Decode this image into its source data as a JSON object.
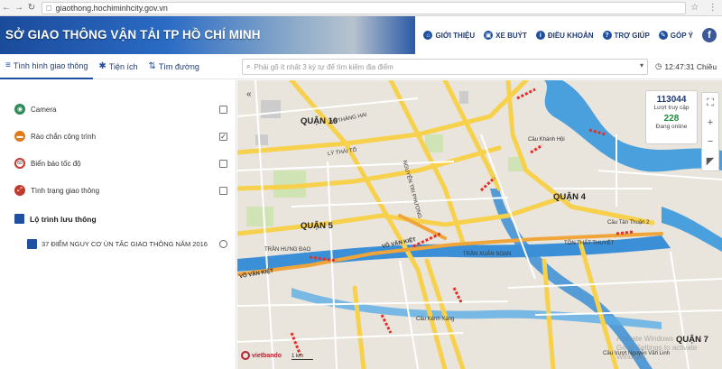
{
  "browser": {
    "url": "giaothong.hochiminhcity.gov.vn"
  },
  "header": {
    "title": "SỞ GIAO THÔNG VẬN TẢI TP HỒ CHÍ MINH",
    "nav": [
      {
        "label": "GIỚI THIỆU",
        "icon": "home-icon"
      },
      {
        "label": "XE BUÝT",
        "icon": "bus-icon"
      },
      {
        "label": "ĐIỀU KHOẢN",
        "icon": "info-icon"
      },
      {
        "label": "TRỢ GIÚP",
        "icon": "help-icon"
      },
      {
        "label": "GÓP Ý",
        "icon": "feedback-icon"
      }
    ],
    "facebook": "f"
  },
  "toolbar": {
    "tabs": [
      {
        "label": "Tình hình giao thông",
        "icon": "layers-icon"
      },
      {
        "label": "Tiện ích",
        "icon": "gear-icon"
      },
      {
        "label": "Tìm đường",
        "icon": "route-icon"
      }
    ],
    "search_placeholder": "Phải gõ ít nhất 3 ký tự để tìm kiếm địa điểm",
    "clock": "12:47:31 Chiều"
  },
  "sidebar": {
    "layers": [
      {
        "label": "Camera",
        "icon": "camera-icon",
        "color": "#2e8b57",
        "checked": false
      },
      {
        "label": "Rào chắn công trình",
        "icon": "barrier-icon",
        "color": "#e07a1f",
        "checked": true
      },
      {
        "label": "Biển báo tốc độ",
        "icon": "speed-sign-icon",
        "color": "#ffffff",
        "checked": false
      },
      {
        "label": "Tình trạng giao thông",
        "icon": "traffic-icon",
        "color": "#c0392b",
        "checked": false
      }
    ],
    "route_title": "Lộ trình lưu thông",
    "route_item": "37 ĐIỂM NGUY CƠ ÙN TẮC GIAO THÔNG NĂM 2016"
  },
  "map": {
    "stats": {
      "visits": "113044",
      "visits_label": "Lượt truy cập",
      "online": "228",
      "online_label": "Đang online"
    },
    "labels": {
      "quan10": "QUẬN 10",
      "quan5": "QUẬN 5",
      "quan4": "QUẬN 4",
      "quan7": "QUẬN 7",
      "vo_van_kiet": "VÕ VĂN KIỆT",
      "vo_van_kiet2": "VÕ VĂN KIỆT",
      "cau_khanh_hoi": "Cầu Khánh Hội",
      "cau_tan_thuan": "Cầu Tân Thuận 2",
      "cau_kenh_xang": "Cầu Kênh Xáng",
      "ton_that_thuyet": "TÔN THẤT THUYẾT",
      "tran_xuan_soan": "TRẦN XUÂN SOẠN",
      "nguyen_tri_phuong": "NGUYỄN TRI PHƯƠNG",
      "tran_hung_dao": "TRẦN HƯNG ĐẠO",
      "ly_thai_to": "LÝ THÁI TỔ",
      "ba_thang_hai": "BA THÁNG HAI",
      "cau_vuot": "Cầu Vượt Nguyễn Văn Linh",
      "brand": "vietbando",
      "scale": "1 km"
    },
    "watermark": "Activate Windows\nGo to Settings to activate Windows."
  }
}
